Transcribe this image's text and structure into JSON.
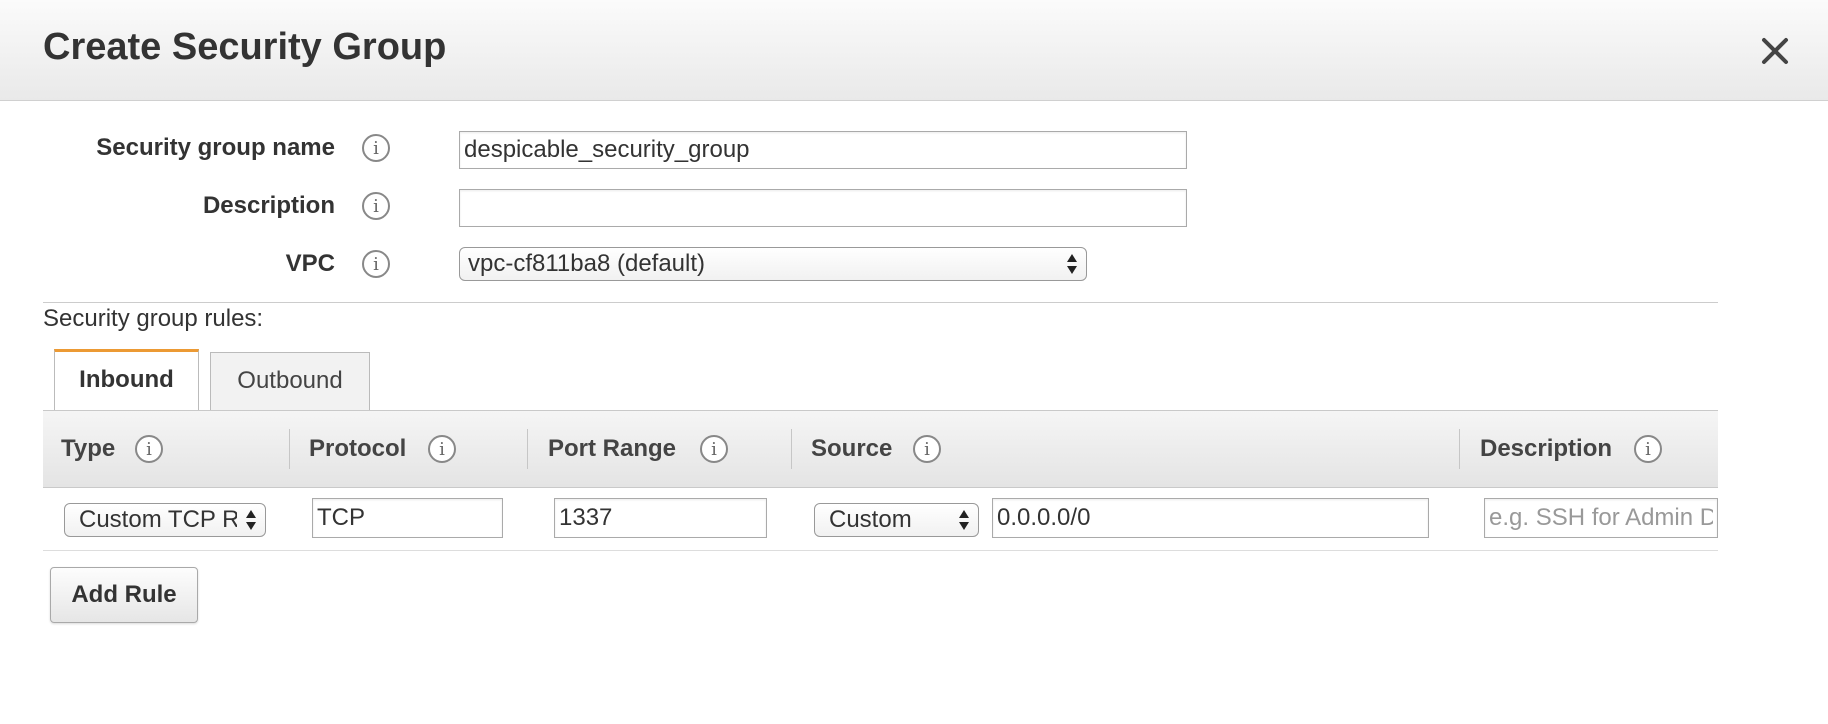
{
  "dialog": {
    "title": "Create Security Group"
  },
  "form": {
    "name_label": "Security group name",
    "name_value": "despicable_security_group",
    "description_label": "Description",
    "description_value": "",
    "vpc_label": "VPC",
    "vpc_selected": "vpc-cf811ba8 (default)"
  },
  "rules": {
    "section_label": "Security group rules:",
    "tabs": [
      {
        "label": "Inbound",
        "active": true
      },
      {
        "label": "Outbound",
        "active": false
      }
    ],
    "columns": [
      "Type",
      "Protocol",
      "Port Range",
      "Source",
      "Description"
    ],
    "row": {
      "type": "Custom TCP R",
      "protocol": "TCP",
      "port_range": "1337",
      "source_type": "Custom",
      "source_value": "0.0.0.0/0",
      "description_placeholder": "e.g. SSH for Admin Desktop"
    },
    "add_rule_label": "Add Rule"
  },
  "icons": {
    "close": "close-icon",
    "info": "info-icon",
    "select_arrows": "select-arrows-icon"
  },
  "colors": {
    "active_tab_accent": "#ec9a34"
  }
}
